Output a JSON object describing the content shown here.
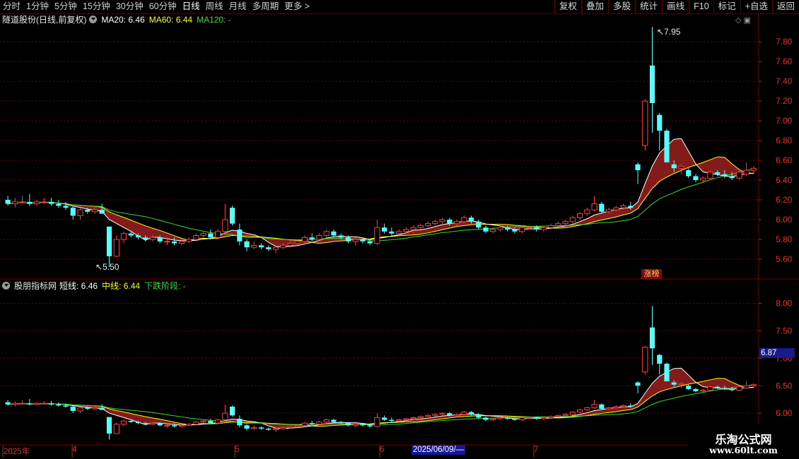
{
  "toolbar": {
    "periods": [
      "分时",
      "1分钟",
      "5分钟",
      "15分钟",
      "30分钟",
      "60分钟",
      "日线",
      "周线",
      "月线",
      "多周期",
      "更多"
    ],
    "active_period": "日线",
    "more_arrow": ">",
    "right_buttons": [
      "复权",
      "叠加",
      "多股",
      "统计",
      "画线",
      "F10",
      "标记",
      "+自选",
      "返回"
    ]
  },
  "main_legend": {
    "stock": "隧道股份(日线,前复权)",
    "ma20": "MA20: 6.46",
    "ma60": "MA60: 6.44",
    "ma120": "MA120: -",
    "ma20_color": "#ffffff",
    "ma60_color": "#ffff00",
    "ma120_color": "#33dd33"
  },
  "sub_legend": {
    "name": "股朋指标网",
    "short": "短线: 6.46",
    "mid": "中线: 6.44",
    "down": "下跌阶段: -",
    "short_color": "#ffffff",
    "mid_color": "#ffff00",
    "down_color": "#33dd33"
  },
  "annotations": {
    "high_label": "7.95",
    "low_label": "5.50",
    "limit_up": "涨榜",
    "current_value": "6.87",
    "crosshair_date": "2025/06/09/—"
  },
  "x_axis": {
    "labels": [
      "2025年",
      "4",
      "5",
      "6",
      "7"
    ]
  },
  "watermark": {
    "line1": "乐淘公式网",
    "line2": "www.60lt.com"
  },
  "colors": {
    "up": "#ff3c3c",
    "down": "#54ffff",
    "grid": "#6a0000",
    "fill": "#9a2020",
    "axis_text": "#d83030"
  },
  "chart_data": {
    "type": "candlestick",
    "main_ylim": [
      5.4,
      7.98
    ],
    "main_yticks": [
      "5.60",
      "5.80",
      "6.00",
      "6.20",
      "6.40",
      "6.60",
      "6.80",
      "7.00",
      "7.20",
      "7.40",
      "7.60",
      "7.80"
    ],
    "sub_ylim": [
      5.45,
      8.25
    ],
    "sub_yticks": [
      "6.00",
      "6.50",
      "7.00",
      "7.50",
      "8.00"
    ],
    "ohlc": [
      [
        6.2,
        6.24,
        6.14,
        6.16
      ],
      [
        6.16,
        6.22,
        6.12,
        6.18
      ],
      [
        6.18,
        6.24,
        6.16,
        6.18
      ],
      [
        6.18,
        6.26,
        6.14,
        6.16
      ],
      [
        6.16,
        6.2,
        6.14,
        6.18
      ],
      [
        6.18,
        6.22,
        6.16,
        6.18
      ],
      [
        6.18,
        6.22,
        6.14,
        6.16
      ],
      [
        6.16,
        6.2,
        6.12,
        6.14
      ],
      [
        6.14,
        6.18,
        6.1,
        6.12
      ],
      [
        6.12,
        6.14,
        6.0,
        6.04
      ],
      [
        6.04,
        6.12,
        6.0,
        6.1
      ],
      [
        6.1,
        6.12,
        6.06,
        6.08
      ],
      [
        6.08,
        6.14,
        6.06,
        6.1
      ],
      [
        6.1,
        6.16,
        6.06,
        6.06
      ],
      [
        5.93,
        5.93,
        5.52,
        5.63
      ],
      [
        5.63,
        5.84,
        5.62,
        5.8
      ],
      [
        5.8,
        5.88,
        5.76,
        5.86
      ],
      [
        5.86,
        5.88,
        5.82,
        5.84
      ],
      [
        5.84,
        5.86,
        5.8,
        5.82
      ],
      [
        5.82,
        5.84,
        5.78,
        5.8
      ],
      [
        5.8,
        5.84,
        5.78,
        5.82
      ],
      [
        5.82,
        5.84,
        5.76,
        5.78
      ],
      [
        5.78,
        5.82,
        5.74,
        5.78
      ],
      [
        5.78,
        5.82,
        5.74,
        5.76
      ],
      [
        5.76,
        5.8,
        5.74,
        5.78
      ],
      [
        5.78,
        5.82,
        5.76,
        5.8
      ],
      [
        5.8,
        5.86,
        5.78,
        5.84
      ],
      [
        5.84,
        5.88,
        5.82,
        5.86
      ],
      [
        5.86,
        5.9,
        5.8,
        5.82
      ],
      [
        5.82,
        5.9,
        5.8,
        5.88
      ],
      [
        5.88,
        6.16,
        5.86,
        6.0
      ],
      [
        6.12,
        6.14,
        5.94,
        5.96
      ],
      [
        5.9,
        5.96,
        5.74,
        5.78
      ],
      [
        5.78,
        5.8,
        5.68,
        5.72
      ],
      [
        5.72,
        5.78,
        5.7,
        5.74
      ],
      [
        5.74,
        5.76,
        5.7,
        5.72
      ],
      [
        5.72,
        5.74,
        5.68,
        5.7
      ],
      [
        5.7,
        5.74,
        5.66,
        5.72
      ],
      [
        5.72,
        5.76,
        5.7,
        5.74
      ],
      [
        5.74,
        5.78,
        5.72,
        5.76
      ],
      [
        5.76,
        5.8,
        5.74,
        5.78
      ],
      [
        5.78,
        5.84,
        5.76,
        5.82
      ],
      [
        5.82,
        5.86,
        5.78,
        5.8
      ],
      [
        5.8,
        5.86,
        5.78,
        5.84
      ],
      [
        5.84,
        5.9,
        5.82,
        5.88
      ],
      [
        5.88,
        5.9,
        5.82,
        5.84
      ],
      [
        5.84,
        5.86,
        5.8,
        5.82
      ],
      [
        5.82,
        5.84,
        5.76,
        5.78
      ],
      [
        5.78,
        5.82,
        5.74,
        5.8
      ],
      [
        5.8,
        5.82,
        5.76,
        5.78
      ],
      [
        5.78,
        5.8,
        5.74,
        5.76
      ],
      [
        5.76,
        6.0,
        5.74,
        5.92
      ],
      [
        5.92,
        5.96,
        5.86,
        5.88
      ],
      [
        5.88,
        5.92,
        5.84,
        5.86
      ],
      [
        5.86,
        5.9,
        5.84,
        5.88
      ],
      [
        5.88,
        5.92,
        5.86,
        5.9
      ],
      [
        5.9,
        5.94,
        5.86,
        5.92
      ],
      [
        5.92,
        5.96,
        5.9,
        5.94
      ],
      [
        5.94,
        5.98,
        5.92,
        5.96
      ],
      [
        5.96,
        6.0,
        5.94,
        5.98
      ],
      [
        5.98,
        6.02,
        5.96,
        6.0
      ],
      [
        6.0,
        6.02,
        5.94,
        5.96
      ],
      [
        5.96,
        6.0,
        5.92,
        5.98
      ],
      [
        5.98,
        6.04,
        5.96,
        6.02
      ],
      [
        6.02,
        6.04,
        5.96,
        5.98
      ],
      [
        5.98,
        6.0,
        5.9,
        5.92
      ],
      [
        5.92,
        5.94,
        5.86,
        5.88
      ],
      [
        5.88,
        5.92,
        5.86,
        5.9
      ],
      [
        5.9,
        5.94,
        5.88,
        5.92
      ],
      [
        5.92,
        5.94,
        5.88,
        5.9
      ],
      [
        5.9,
        5.92,
        5.86,
        5.88
      ],
      [
        5.88,
        5.94,
        5.86,
        5.92
      ],
      [
        5.92,
        5.94,
        5.9,
        5.92
      ],
      [
        5.92,
        5.94,
        5.88,
        5.9
      ],
      [
        5.9,
        5.94,
        5.88,
        5.92
      ],
      [
        5.92,
        5.96,
        5.9,
        5.94
      ],
      [
        5.94,
        5.98,
        5.92,
        5.96
      ],
      [
        5.96,
        6.0,
        5.94,
        5.98
      ],
      [
        5.98,
        6.04,
        5.96,
        6.02
      ],
      [
        6.02,
        6.08,
        6.0,
        6.06
      ],
      [
        6.06,
        6.12,
        6.04,
        6.1
      ],
      [
        6.1,
        6.24,
        6.08,
        6.16
      ],
      [
        6.16,
        6.18,
        6.06,
        6.08
      ],
      [
        6.08,
        6.12,
        6.06,
        6.1
      ],
      [
        6.1,
        6.14,
        6.08,
        6.12
      ],
      [
        6.12,
        6.16,
        6.1,
        6.14
      ],
      [
        6.14,
        6.18,
        6.1,
        6.12
      ],
      [
        6.56,
        6.58,
        6.36,
        6.5
      ],
      [
        6.75,
        7.22,
        6.7,
        7.2
      ],
      [
        7.56,
        7.95,
        6.88,
        7.18
      ],
      [
        7.06,
        7.08,
        6.7,
        6.9
      ],
      [
        6.9,
        6.92,
        6.58,
        6.58
      ],
      [
        6.56,
        6.6,
        6.48,
        6.52
      ],
      [
        6.52,
        6.56,
        6.46,
        6.54
      ],
      [
        6.5,
        6.52,
        6.42,
        6.44
      ],
      [
        6.44,
        6.46,
        6.38,
        6.4
      ],
      [
        6.4,
        6.44,
        6.38,
        6.42
      ],
      [
        6.42,
        6.5,
        6.4,
        6.48
      ],
      [
        6.48,
        6.5,
        6.44,
        6.46
      ],
      [
        6.46,
        6.5,
        6.42,
        6.44
      ],
      [
        6.44,
        6.48,
        6.4,
        6.42
      ],
      [
        6.42,
        6.5,
        6.4,
        6.48
      ],
      [
        6.46,
        6.58,
        6.44,
        6.5
      ],
      [
        6.5,
        6.54,
        6.46,
        6.52
      ]
    ]
  }
}
